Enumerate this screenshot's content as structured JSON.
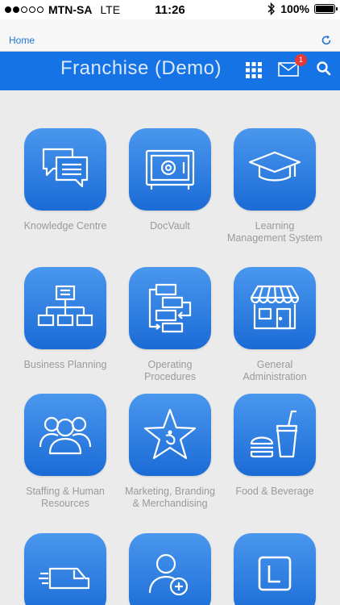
{
  "status": {
    "carrier": "MTN-SA",
    "network": "LTE",
    "time": "11:26",
    "battery": "100%",
    "signal_bars_filled": 2,
    "signal_bars_total": 5
  },
  "browser": {
    "home_label": "Home",
    "refresh_icon": "refresh-icon"
  },
  "header": {
    "title": "Franchise (Demo)",
    "mail_badge": "1",
    "accent": "#1573e5"
  },
  "tiles": [
    {
      "label": "Knowledge Centre",
      "icon": "chat-bubbles-icon"
    },
    {
      "label": "DocVault",
      "icon": "safe-icon"
    },
    {
      "label": "Learning Management System",
      "icon": "graduation-cap-icon"
    },
    {
      "label": "Business Planning",
      "icon": "org-chart-icon"
    },
    {
      "label": "Operating Procedures",
      "icon": "flow-process-icon"
    },
    {
      "label": "General Administration",
      "icon": "storefront-icon"
    },
    {
      "label": "Staffing & Human Resources",
      "icon": "people-group-icon"
    },
    {
      "label": "Marketing, Branding & Merchandising",
      "icon": "star-icon"
    },
    {
      "label": "Food & Beverage",
      "icon": "burger-drink-icon"
    },
    {
      "label": "",
      "icon": "delivery-van-icon"
    },
    {
      "label": "",
      "icon": "add-user-icon"
    },
    {
      "label": "",
      "icon": "l-letter-icon"
    }
  ]
}
